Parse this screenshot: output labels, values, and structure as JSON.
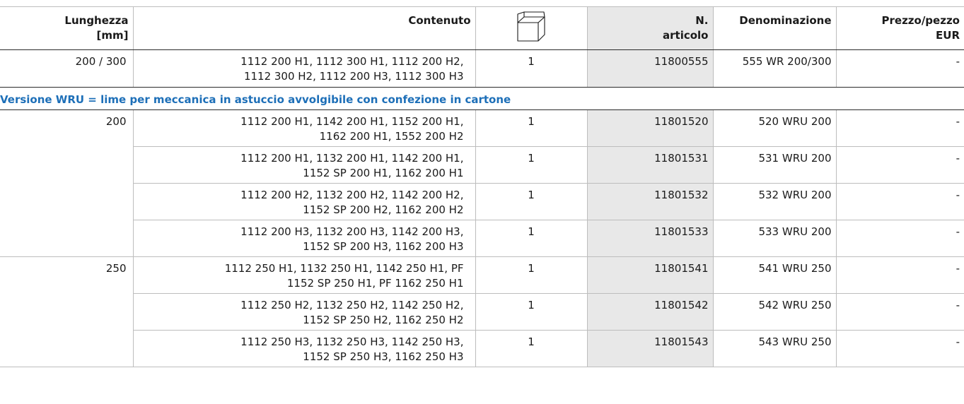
{
  "header": {
    "length_label_1": "Lunghezza",
    "length_label_2": "[mm]",
    "content_label": "Contenuto",
    "package_icon": "box-icon",
    "article_label_1": "N.",
    "article_label_2": "articolo",
    "name_label": "Denominazione",
    "price_label_1": "Prezzo/pezzo",
    "price_label_2": "EUR"
  },
  "first_row": {
    "length": "200 / 300",
    "content_1": "1112 200 H1, 1112 300 H1, 1112 200 H2,",
    "content_2": "1112 300 H2, 1112 200 H3, 1112 300 H3",
    "qty": "1",
    "article": "11800555",
    "name": "555 WR 200/300",
    "price": "-"
  },
  "section": {
    "title": "Versione WRU = lime per meccanica in astuccio avvolgibile con confezione in cartone",
    "title_color": "#1d6fb8"
  },
  "groups": [
    {
      "length": "200",
      "rows": [
        {
          "content_1": "1112 200 H1, 1142 200 H1, 1152 200 H1,",
          "content_2": "1162 200 H1, 1552 200 H2",
          "qty": "1",
          "article": "11801520",
          "name": "520 WRU 200",
          "price": "-"
        },
        {
          "content_1": "1112 200 H1, 1132 200 H1, 1142 200 H1,",
          "content_2": "1152 SP 200 H1, 1162 200 H1",
          "qty": "1",
          "article": "11801531",
          "name": "531 WRU 200",
          "price": "-"
        },
        {
          "content_1": "1112 200 H2, 1132 200 H2, 1142 200 H2,",
          "content_2": "1152 SP 200 H2, 1162 200 H2",
          "qty": "1",
          "article": "11801532",
          "name": "532 WRU 200",
          "price": "-"
        },
        {
          "content_1": "1112 200 H3, 1132 200 H3, 1142 200 H3,",
          "content_2": "1152 SP 200 H3, 1162 200 H3",
          "qty": "1",
          "article": "11801533",
          "name": "533 WRU 200",
          "price": "-"
        }
      ]
    },
    {
      "length": "250",
      "rows": [
        {
          "content_1": "1112 250 H1, 1132 250 H1, 1142 250 H1, PF",
          "content_2": "1152 SP 250 H1, PF 1162 250 H1",
          "qty": "1",
          "article": "11801541",
          "name": "541 WRU 250",
          "price": "-"
        },
        {
          "content_1": "1112 250 H2, 1132 250 H2, 1142 250 H2,",
          "content_2": "1152 SP 250 H2, 1162 250 H2",
          "qty": "1",
          "article": "11801542",
          "name": "542 WRU 250",
          "price": "-"
        },
        {
          "content_1": "1112 250 H3, 1132 250 H3, 1142 250 H3,",
          "content_2": "1152 SP 250 H3, 1162 250 H3",
          "qty": "1",
          "article": "11801543",
          "name": "543 WRU 250",
          "price": "-"
        }
      ]
    }
  ]
}
